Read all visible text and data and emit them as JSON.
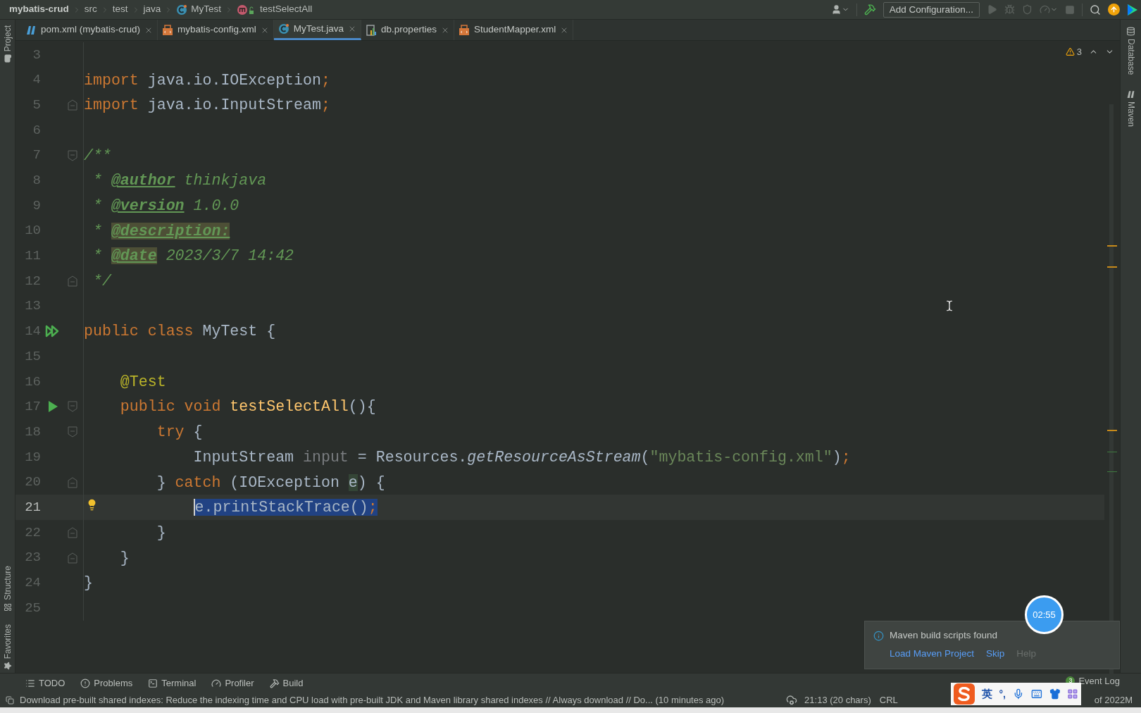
{
  "breadcrumbs": [
    {
      "label": "mybatis-crud",
      "kind": "project"
    },
    {
      "label": "src",
      "kind": "folder"
    },
    {
      "label": "test",
      "kind": "folder"
    },
    {
      "label": "java",
      "kind": "folder"
    },
    {
      "label": "MyTest",
      "kind": "class"
    },
    {
      "label": "testSelectAll",
      "kind": "method"
    }
  ],
  "toolbar": {
    "run_config": "Add Configuration..."
  },
  "tabs": [
    {
      "label": "pom.xml (mybatis-crud)",
      "kind": "maven",
      "selected": false
    },
    {
      "label": "mybatis-config.xml",
      "kind": "xml",
      "selected": false
    },
    {
      "label": "MyTest.java",
      "kind": "class",
      "selected": true
    },
    {
      "label": "db.properties",
      "kind": "properties",
      "selected": false
    },
    {
      "label": "StudentMapper.xml",
      "kind": "xml",
      "selected": false
    }
  ],
  "left_strip": {
    "top": [
      {
        "label": "Project",
        "kind": "folder"
      }
    ],
    "bottom": [
      {
        "label": "Structure",
        "kind": "structure"
      },
      {
        "label": "Favorites",
        "kind": "star"
      }
    ]
  },
  "right_strip": [
    {
      "label": "Database",
      "kind": "database"
    },
    {
      "label": "Maven",
      "kind": "maven"
    }
  ],
  "inspections": {
    "warnings": "3"
  },
  "lines": [
    {
      "number": "3",
      "current": false
    },
    {
      "number": "4",
      "current": false,
      "tokens": [
        {
          "text": "import",
          "kind": "keyword"
        },
        {
          "text": " java.io.IOException",
          "kind": "plain"
        },
        {
          "text": ";",
          "kind": "punct"
        }
      ]
    },
    {
      "number": "5",
      "current": false,
      "fold": {
        "kind": "end"
      },
      "tokens": [
        {
          "text": "import",
          "kind": "keyword"
        },
        {
          "text": " java.io.InputStream",
          "kind": "plain"
        },
        {
          "text": ";",
          "kind": "punct"
        }
      ]
    },
    {
      "number": "6",
      "current": false
    },
    {
      "number": "7",
      "current": false,
      "fold": {
        "kind": "start"
      },
      "tokens": [
        {
          "text": "/**",
          "kind": "comment"
        }
      ]
    },
    {
      "number": "8",
      "current": false,
      "tokens": [
        {
          "text": " * ",
          "kind": "comment"
        },
        {
          "text": "@author",
          "kind": "doctag"
        },
        {
          "text": " thinkjava",
          "kind": "comment"
        }
      ]
    },
    {
      "number": "9",
      "current": false,
      "tokens": [
        {
          "text": " * ",
          "kind": "comment"
        },
        {
          "text": "@version",
          "kind": "doctag"
        },
        {
          "text": " 1.0.0",
          "kind": "comment"
        }
      ]
    },
    {
      "number": "10",
      "current": false,
      "tokens": [
        {
          "text": " * ",
          "kind": "comment"
        },
        {
          "text": "@description:",
          "kind": "doctag_marked"
        }
      ]
    },
    {
      "number": "11",
      "current": false,
      "tokens": [
        {
          "text": " * ",
          "kind": "comment"
        },
        {
          "text": "@date",
          "kind": "doctag_marked"
        },
        {
          "text": " 2023/3/7 14:42",
          "kind": "comment"
        }
      ]
    },
    {
      "number": "12",
      "current": false,
      "fold": {
        "kind": "end"
      },
      "tokens": [
        {
          "text": " */",
          "kind": "comment"
        }
      ]
    },
    {
      "number": "13",
      "current": false
    },
    {
      "number": "14",
      "current": false,
      "gutter": {
        "kind": "run_class"
      },
      "tokens": [
        {
          "text": "public class",
          "kind": "keyword"
        },
        {
          "text": " MyTest {",
          "kind": "plain"
        }
      ]
    },
    {
      "number": "15",
      "current": false
    },
    {
      "number": "16",
      "current": false,
      "tokens": [
        {
          "text": "    @Test",
          "kind": "annotation"
        }
      ]
    },
    {
      "number": "17",
      "current": false,
      "gutter": {
        "kind": "run"
      },
      "fold": {
        "kind": "start"
      },
      "tokens": [
        {
          "text": "    public void ",
          "kind": "keyword"
        },
        {
          "text": "testSelectAll",
          "kind": "method_decl"
        },
        {
          "text": "(){",
          "kind": "plain"
        }
      ]
    },
    {
      "number": "18",
      "current": false,
      "fold": {
        "kind": "start"
      },
      "tokens": [
        {
          "text": "        try",
          "kind": "keyword"
        },
        {
          "text": " {",
          "kind": "plain"
        }
      ]
    },
    {
      "number": "19",
      "current": false,
      "tokens": [
        {
          "text": "            InputStream ",
          "kind": "plain"
        },
        {
          "text": "input",
          "kind": "unused"
        },
        {
          "text": " = Resources.",
          "kind": "plain"
        },
        {
          "text": "getResourceAsStream",
          "kind": "static_call"
        },
        {
          "text": "(",
          "kind": "plain"
        },
        {
          "text": "\"mybatis-config.xml\"",
          "kind": "string"
        },
        {
          "text": ")",
          "kind": "plain"
        },
        {
          "text": ";",
          "kind": "punct"
        }
      ]
    },
    {
      "number": "20",
      "current": false,
      "fold": {
        "kind": "end"
      },
      "tokens": [
        {
          "text": "        } ",
          "kind": "plain"
        },
        {
          "text": "catch",
          "kind": "keyword"
        },
        {
          "text": " (IOException ",
          "kind": "plain"
        },
        {
          "text": "e",
          "kind": "marked"
        },
        {
          "text": ") {",
          "kind": "plain"
        }
      ]
    },
    {
      "number": "21",
      "current": true,
      "gutter": {
        "kind": "bulb"
      },
      "tokens": [
        {
          "text": "            e.printStackTrace()",
          "kind": "selected"
        },
        {
          "text": ";",
          "kind": "selected_punct"
        }
      ]
    },
    {
      "number": "22",
      "current": false,
      "fold": {
        "kind": "end"
      },
      "tokens": [
        {
          "text": "        }",
          "kind": "plain"
        }
      ]
    },
    {
      "number": "23",
      "current": false,
      "fold": {
        "kind": "end"
      },
      "tokens": [
        {
          "text": "    }",
          "kind": "plain"
        }
      ]
    },
    {
      "number": "24",
      "current": false,
      "tokens": [
        {
          "text": "}",
          "kind": "plain"
        }
      ]
    },
    {
      "number": "25",
      "current": false
    }
  ],
  "notification": {
    "title": "Maven build scripts found",
    "actions": [
      {
        "label": "Load Maven Project",
        "disabled": false
      },
      {
        "label": "Skip",
        "disabled": false
      },
      {
        "label": "Help",
        "disabled": true
      }
    ]
  },
  "timer": "02:55",
  "tool_windows": [
    {
      "label": "TODO",
      "kind": "todo"
    },
    {
      "label": "Problems",
      "kind": "problems"
    },
    {
      "label": "Terminal",
      "kind": "terminal"
    },
    {
      "label": "Profiler",
      "kind": "profiler"
    },
    {
      "label": "Build",
      "kind": "build"
    }
  ],
  "event_log": {
    "label": "Event Log",
    "count": "3"
  },
  "status_bar": {
    "message": "Download pre-built shared indexes: Reduce the indexing time and CPU load with pre-built JDK and Maven library shared indexes // Always download // Do... (10 minutes ago)",
    "position": "21:13 (20 chars)",
    "line_separator": "CRL",
    "memory": "of 2022M"
  },
  "ime": {
    "mode": "英",
    "punct": "°,"
  }
}
